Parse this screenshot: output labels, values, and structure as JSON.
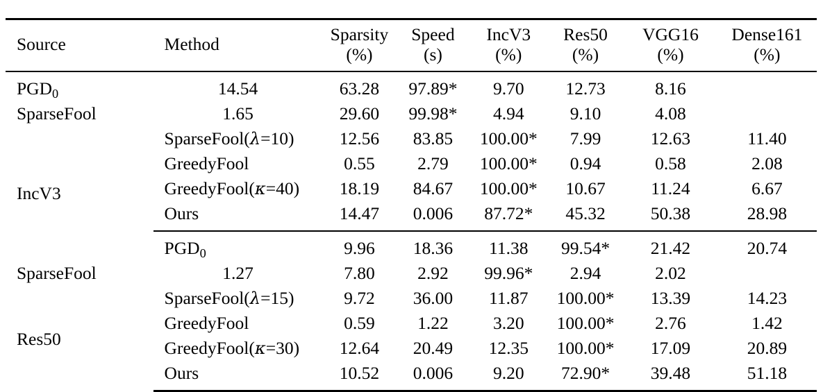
{
  "table": {
    "columns": [
      {
        "key": "source",
        "label": "Source",
        "unit": ""
      },
      {
        "key": "method",
        "label": "Method",
        "unit": ""
      },
      {
        "key": "sparsity",
        "label": "Sparsity",
        "unit": "(%)"
      },
      {
        "key": "speed",
        "label": "Speed",
        "unit": "(s)"
      },
      {
        "key": "incv3",
        "label": "IncV3",
        "unit": "(%)"
      },
      {
        "key": "res50",
        "label": "Res50",
        "unit": "(%)"
      },
      {
        "key": "vgg16",
        "label": "VGG16",
        "unit": "(%)"
      },
      {
        "key": "dense161",
        "label": "Dense161",
        "unit": "(%)"
      }
    ],
    "blocks": [
      {
        "source": "IncV3",
        "rows": [
          {
            "method_prefix": "PGD",
            "method_sub": "0",
            "method_suffix": "",
            "sparsity": "14.54",
            "speed": "63.28",
            "incv3": "97.89*",
            "res50": "9.70",
            "vgg16": "12.73",
            "dense161": "8.16",
            "bold": []
          },
          {
            "method_prefix": "SparseFool",
            "method_sub": "",
            "method_suffix": "",
            "sparsity": "1.65",
            "speed": "29.60",
            "incv3": "99.98*",
            "res50": "4.94",
            "vgg16": "9.10",
            "dense161": "4.08",
            "bold": []
          },
          {
            "method_prefix": "SparseFool(",
            "method_sub": "",
            "method_greek": "λ",
            "method_suffix": "=10)",
            "sparsity": "12.56",
            "speed": "83.85",
            "incv3": "100.00*",
            "res50": "7.99",
            "vgg16": "12.63",
            "dense161": "11.40",
            "bold": []
          },
          {
            "method_prefix": "GreedyFool",
            "method_sub": "",
            "method_suffix": "",
            "sparsity": "0.55",
            "speed": "2.79",
            "incv3": "100.00*",
            "res50": "0.94",
            "vgg16": "0.58",
            "dense161": "2.08",
            "bold": []
          },
          {
            "method_prefix": "GreedyFool(",
            "method_sub": "",
            "method_greek": "κ",
            "method_suffix": "=40)",
            "sparsity": "18.19",
            "speed": "84.67",
            "incv3": "100.00*",
            "res50": "10.67",
            "vgg16": "11.24",
            "dense161": "6.67",
            "bold": []
          },
          {
            "method_prefix": "Ours",
            "method_sub": "",
            "method_suffix": "",
            "sparsity": "14.47",
            "speed": "0.006",
            "incv3": "87.72*",
            "res50": "45.32",
            "vgg16": "50.38",
            "dense161": "28.98",
            "bold": [
              "speed",
              "res50",
              "vgg16",
              "dense161"
            ]
          }
        ]
      },
      {
        "source": "Res50",
        "rows": [
          {
            "method_prefix": "PGD",
            "method_sub": "0",
            "method_suffix": "",
            "sparsity": "9.96",
            "speed": "18.36",
            "incv3": "11.38",
            "res50": "99.54*",
            "vgg16": "21.42",
            "dense161": "20.74",
            "bold": []
          },
          {
            "method_prefix": "SparseFool",
            "method_sub": "",
            "method_suffix": "",
            "sparsity": "1.27",
            "speed": "7.80",
            "incv3": "2.92",
            "res50": "99.96*",
            "vgg16": "2.94",
            "dense161": "2.02",
            "bold": []
          },
          {
            "method_prefix": "SparseFool(",
            "method_sub": "",
            "method_greek": "λ",
            "method_suffix": "=15)",
            "sparsity": "9.72",
            "speed": "36.00",
            "incv3": "11.87",
            "res50": "100.00*",
            "vgg16": "13.39",
            "dense161": "14.23",
            "bold": []
          },
          {
            "method_prefix": "GreedyFool",
            "method_sub": "",
            "method_suffix": "",
            "sparsity": "0.59",
            "speed": "1.22",
            "incv3": "3.20",
            "res50": "100.00*",
            "vgg16": "2.76",
            "dense161": "1.42",
            "bold": []
          },
          {
            "method_prefix": "GreedyFool(",
            "method_sub": "",
            "method_greek": "κ",
            "method_suffix": "=30)",
            "sparsity": "12.64",
            "speed": "20.49",
            "incv3": "12.35",
            "res50": "100.00*",
            "vgg16": "17.09",
            "dense161": "20.89",
            "bold": [
              "incv3"
            ]
          },
          {
            "method_prefix": "Ours",
            "method_sub": "",
            "method_suffix": "",
            "sparsity": "10.52",
            "speed": "0.006",
            "incv3": "9.20",
            "res50": "72.90*",
            "vgg16": "39.48",
            "dense161": "51.18",
            "bold": [
              "speed",
              "vgg16",
              "dense161"
            ]
          }
        ]
      }
    ]
  }
}
